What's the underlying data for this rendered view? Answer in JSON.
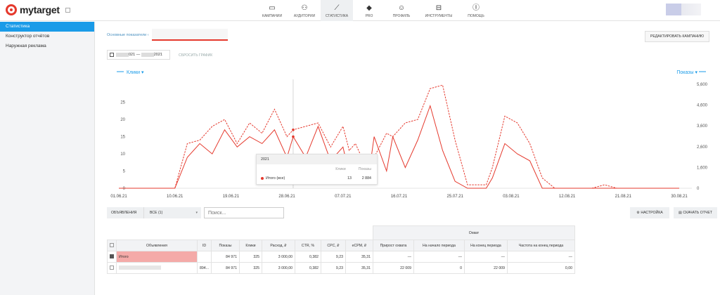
{
  "app": {
    "logo": "mytarget"
  },
  "nav": [
    {
      "label": "Кампании",
      "icon": "monitor-icon"
    },
    {
      "label": "Аудитории",
      "icon": "people-icon"
    },
    {
      "label": "Статистика",
      "icon": "chart-line-icon"
    },
    {
      "label": "PRO",
      "icon": "graduation-cap-icon"
    },
    {
      "label": "Профиль",
      "icon": "user-icon"
    },
    {
      "label": "Инструменты",
      "icon": "tools-icon"
    },
    {
      "label": "Помощь",
      "icon": "help-icon"
    }
  ],
  "sidebar": {
    "items": [
      "Статистика",
      "Конструктор отчётов",
      "Наружная реклама"
    ]
  },
  "tabs": {
    "main": "Основные показатели"
  },
  "buttons": {
    "edit_campaign": "Редактировать кампанию",
    "reset_graph": "Сбросить график",
    "settings": "Настройка",
    "download": "Скачать отчет"
  },
  "date": {
    "from": "021",
    "to": "2021"
  },
  "chart_toggles": {
    "left": "Клики",
    "right": "Показы"
  },
  "chart_data": {
    "type": "line",
    "x_ticks": [
      "01.06.21",
      "10.06.21",
      "19.06.21",
      "28.06.21",
      "07.07.21",
      "16.07.21",
      "25.07.21",
      "03.08.21",
      "12.08.21",
      "21.08.21",
      "30.08.21"
    ],
    "y_left_ticks": [
      "0",
      "5",
      "10",
      "15",
      "20",
      "25"
    ],
    "y_right_ticks": [
      "0",
      "1,600",
      "2,600",
      "3,600",
      "4,600",
      "5,600"
    ],
    "y_left_lim": [
      0,
      28
    ],
    "x_lim": [
      0,
      90
    ],
    "series": [
      {
        "name": "Клики",
        "style": "solid",
        "color": "#e5392d",
        "points": [
          [
            0,
            0
          ],
          [
            9,
            0
          ],
          [
            11,
            9
          ],
          [
            13,
            13
          ],
          [
            15,
            10
          ],
          [
            17,
            17
          ],
          [
            19,
            12
          ],
          [
            21,
            15
          ],
          [
            23,
            13
          ],
          [
            25,
            17
          ],
          [
            27,
            9
          ],
          [
            28,
            15
          ],
          [
            30,
            9
          ],
          [
            32,
            18
          ],
          [
            34,
            8
          ],
          [
            36,
            12
          ],
          [
            37,
            4
          ],
          [
            38,
            7
          ],
          [
            40,
            2
          ],
          [
            41,
            15
          ],
          [
            43,
            5
          ],
          [
            44,
            15
          ],
          [
            46,
            6
          ],
          [
            48,
            14
          ],
          [
            50,
            24
          ],
          [
            52,
            11
          ],
          [
            54,
            2
          ],
          [
            56,
            0
          ],
          [
            58,
            0
          ],
          [
            59,
            0
          ],
          [
            60,
            3
          ],
          [
            62,
            13
          ],
          [
            64,
            10
          ],
          [
            66,
            8
          ],
          [
            68,
            0
          ],
          [
            70,
            0
          ],
          [
            80,
            0
          ],
          [
            90,
            0
          ]
        ]
      },
      {
        "name": "Показы",
        "style": "dashed",
        "color": "#e5392d",
        "points": [
          [
            0,
            0
          ],
          [
            9,
            0
          ],
          [
            11,
            13
          ],
          [
            13,
            14
          ],
          [
            15,
            18
          ],
          [
            17,
            20
          ],
          [
            19,
            13
          ],
          [
            21,
            19
          ],
          [
            23,
            16
          ],
          [
            25,
            23
          ],
          [
            27,
            15
          ],
          [
            28,
            17
          ],
          [
            30,
            18
          ],
          [
            32,
            19
          ],
          [
            34,
            12
          ],
          [
            36,
            18
          ],
          [
            37,
            11
          ],
          [
            38,
            13
          ],
          [
            40,
            5
          ],
          [
            41,
            9
          ],
          [
            43,
            16
          ],
          [
            44,
            15
          ],
          [
            46,
            19
          ],
          [
            48,
            20
          ],
          [
            50,
            29
          ],
          [
            52,
            30
          ],
          [
            54,
            14
          ],
          [
            56,
            1
          ],
          [
            58,
            1
          ],
          [
            59,
            1
          ],
          [
            60,
            6
          ],
          [
            62,
            21
          ],
          [
            64,
            19
          ],
          [
            66,
            13
          ],
          [
            68,
            3
          ],
          [
            70,
            0
          ],
          [
            72,
            0
          ],
          [
            74,
            0
          ],
          [
            76,
            0
          ],
          [
            78,
            1
          ],
          [
            80,
            0
          ],
          [
            90,
            0
          ]
        ]
      }
    ]
  },
  "tooltip": {
    "title": "2021",
    "col1": "Клики",
    "col2": "Показы",
    "row_label": "Итого (все)",
    "clicks": "13",
    "shows": "2 884"
  },
  "filters": {
    "label": "Объявления",
    "value": "все",
    "count": "(1)",
    "search_placeholder": "Поиск..."
  },
  "table": {
    "group_header": "Охват",
    "headers": [
      "Объявления",
      "ID",
      "Показы",
      "Клики",
      "Расход, ₽",
      "CTR, %",
      "CPC, ₽",
      "eCPM, ₽",
      "Прирост охвата",
      "На начало периода",
      "На конец периода",
      "Частота на конец периода"
    ],
    "rows": [
      {
        "name": "Итого",
        "id": "",
        "shows": "84 971",
        "clicks": "325",
        "spend": "3 000,00",
        "ctr": "0,382",
        "cpc": "9,23",
        "ecpm": "35,31",
        "growth": "—",
        "start": "—",
        "end": "—",
        "freq": "—",
        "checked": true
      },
      {
        "name": "",
        "id": "894...",
        "shows": "84 971",
        "clicks": "325",
        "spend": "3 000,00",
        "ctr": "0,382",
        "cpc": "9,23",
        "ecpm": "35,31",
        "growth": "22 009",
        "start": "0",
        "end": "22 009",
        "freq": "0,00",
        "checked": false
      }
    ]
  }
}
